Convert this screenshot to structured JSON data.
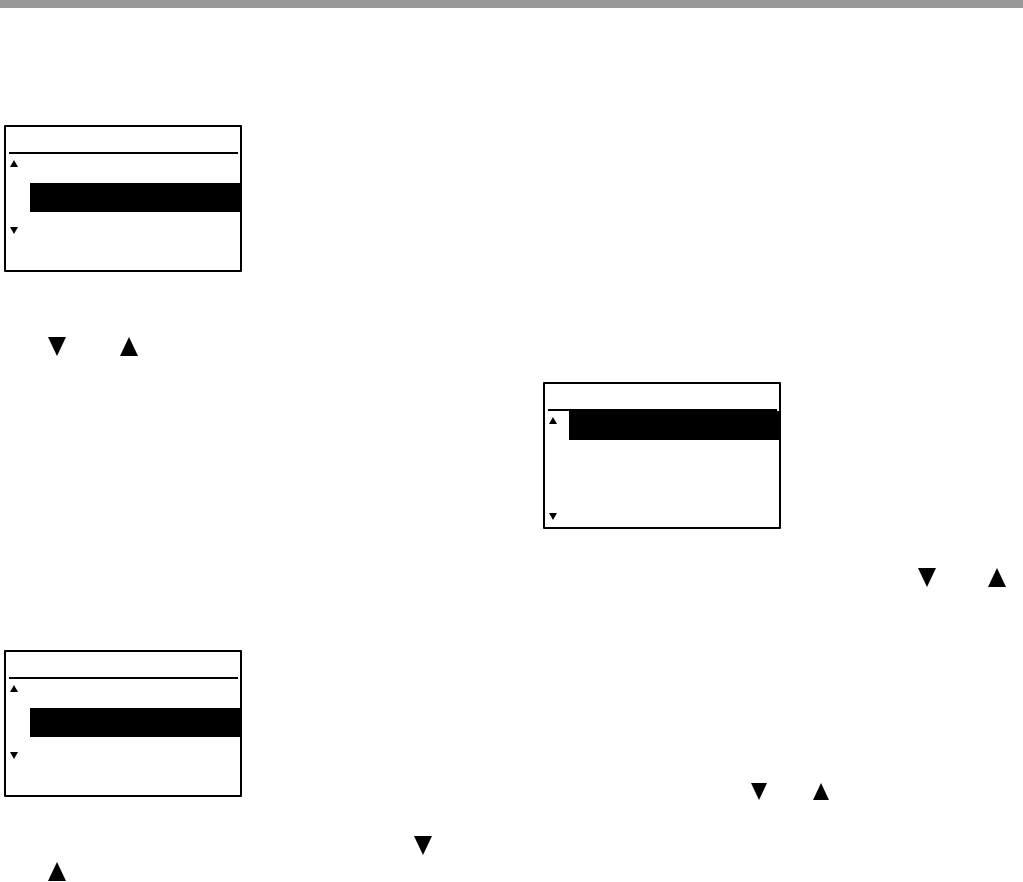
{
  "left_column": [
    {
      "kind": "screen",
      "rows": [
        {
          "selected": false,
          "scroll_up": true,
          "scroll_down": false
        },
        {
          "selected": true,
          "scroll_up": false,
          "scroll_down": false
        },
        {
          "selected": false,
          "scroll_up": false,
          "scroll_down": true
        },
        {
          "selected": false,
          "scroll_up": false,
          "scroll_down": false
        }
      ]
    },
    {
      "kind": "keys",
      "marks": [
        {
          "kind": "down"
        },
        {
          "kind": "up"
        }
      ]
    },
    {
      "kind": "screen",
      "rows": [
        {
          "selected": false,
          "scroll_up": true,
          "scroll_down": false
        },
        {
          "selected": true,
          "scroll_up": false,
          "scroll_down": false
        },
        {
          "selected": false,
          "scroll_up": false,
          "scroll_down": true
        },
        {
          "selected": false,
          "scroll_up": false,
          "scroll_down": false
        }
      ]
    },
    {
      "kind": "keys",
      "marks": [
        {
          "kind": "down"
        }
      ]
    },
    {
      "kind": "keys",
      "marks": [
        {
          "kind": "up"
        }
      ]
    }
  ],
  "right_column": [
    {
      "kind": "screen",
      "rows": [
        {
          "selected": true,
          "scroll_up": true,
          "scroll_down": false
        },
        {
          "selected": false,
          "scroll_up": false,
          "scroll_down": false
        },
        {
          "selected": false,
          "scroll_up": false,
          "scroll_down": false
        },
        {
          "selected": false,
          "scroll_up": false,
          "scroll_down": true
        }
      ]
    },
    {
      "kind": "keys",
      "marks": [
        {
          "kind": "down"
        },
        {
          "kind": "up"
        }
      ]
    },
    {
      "kind": "keys",
      "marks": [
        {
          "kind": "down"
        },
        {
          "kind": "up"
        }
      ]
    }
  ]
}
